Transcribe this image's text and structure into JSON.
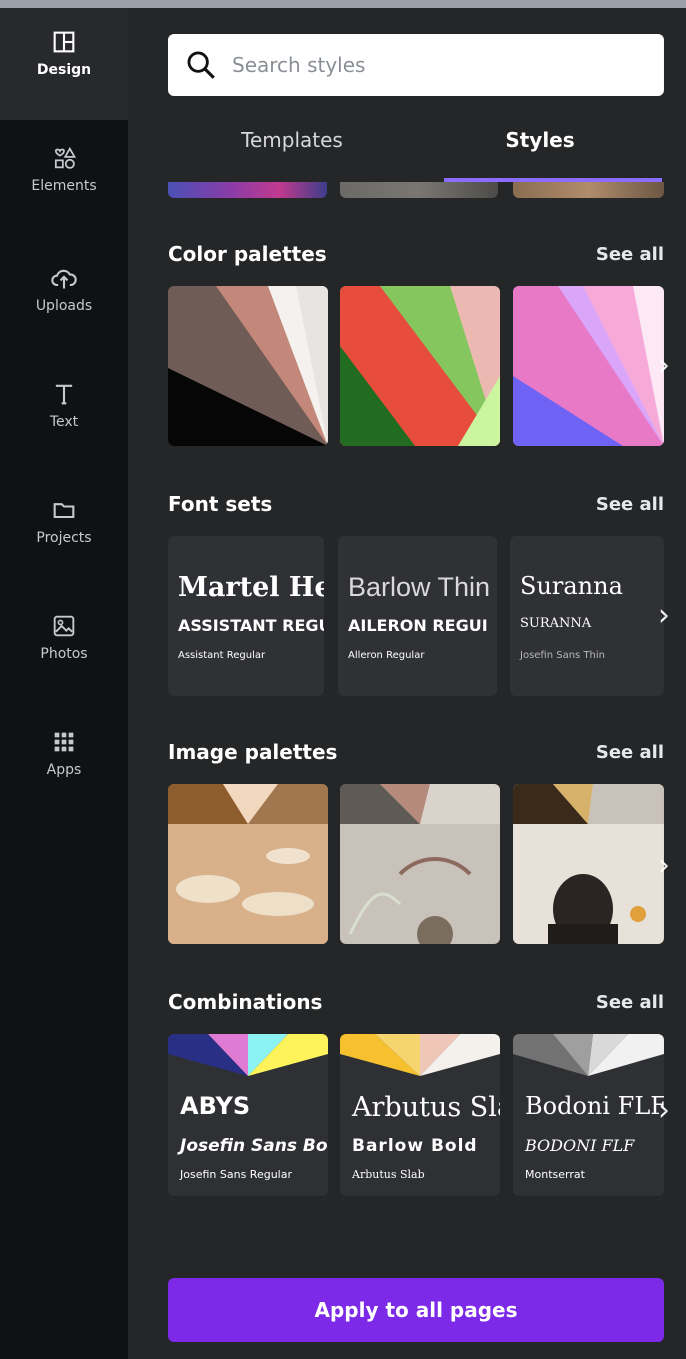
{
  "sidebar": {
    "items": [
      {
        "label": "Design",
        "icon": "layout-icon"
      },
      {
        "label": "Elements",
        "icon": "shapes-icon"
      },
      {
        "label": "Uploads",
        "icon": "upload-cloud-icon"
      },
      {
        "label": "Text",
        "icon": "text-icon"
      },
      {
        "label": "Projects",
        "icon": "folder-icon"
      },
      {
        "label": "Photos",
        "icon": "photo-icon"
      },
      {
        "label": "Apps",
        "icon": "grid-icon"
      }
    ]
  },
  "search": {
    "placeholder": "Search styles"
  },
  "tabs": [
    {
      "label": "Templates"
    },
    {
      "label": "Styles"
    }
  ],
  "sections": {
    "color_palettes": {
      "title": "Color palettes",
      "see_all": "See all"
    },
    "font_sets": {
      "title": "Font sets",
      "see_all": "See all"
    },
    "image_palettes": {
      "title": "Image palettes",
      "see_all": "See all"
    },
    "combinations": {
      "title": "Combinations",
      "see_all": "See all"
    }
  },
  "font_sets": [
    {
      "title": "Martel He",
      "subtitle": "ASSISTANT REGU",
      "small": "Assistant Regular"
    },
    {
      "title": "Barlow Thin",
      "subtitle": "AILERON REGUI",
      "small": "Alleron Regular"
    },
    {
      "title": "Suranna",
      "subtitle": "SURANNA",
      "small": "Josefin Sans Thin"
    }
  ],
  "combinations": [
    {
      "title": "ABYS",
      "subtitle": "Josefin Sans Bol",
      "small": "Josefin Sans Regular"
    },
    {
      "title": "Arbutus Sla",
      "subtitle": "Barlow Bold",
      "small": "Arbutus Slab"
    },
    {
      "title": "Bodoni FLF",
      "subtitle": "BODONI FLF",
      "small": "Montserrat"
    }
  ],
  "actions": {
    "apply_label": "Apply to all pages"
  },
  "colors": {
    "accent": "#7d2ae8",
    "tab_underline": "#8b6dfd"
  }
}
